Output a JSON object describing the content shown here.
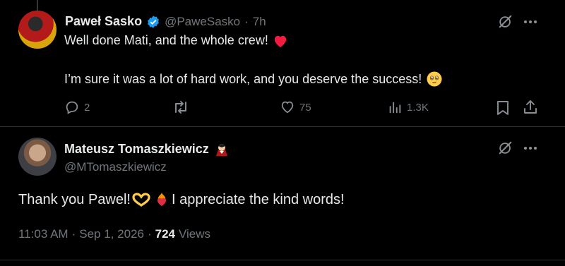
{
  "reply": {
    "author_name": "Paweł Sasko",
    "handle": "@PaweSasko",
    "separator": "·",
    "time_ago": "7h",
    "line1": "Well done Mati, and the whole crew!",
    "line2": "I’m sure it was a lot of hard work, and you deserve the success!",
    "emoji_heart": "❤",
    "emoji_face": "🥹",
    "stats": {
      "replies": "2",
      "likes": "75",
      "views": "1.3K"
    }
  },
  "main_post": {
    "author_name": "Mateusz Tomaszkiewicz",
    "author_emoji": "🧛",
    "handle": "@MTomaszkiewicz",
    "text_part1": "Thank you Pawel!",
    "emoji_hands": "🫶",
    "emoji_fire": "❤️‍🔥",
    "text_part2": "I appreciate the kind words!",
    "time": "11:03 AM",
    "dot1": "·",
    "date": "Sep 1, 2026",
    "dot2": "·",
    "views_count": "724",
    "views_label": "Views"
  },
  "colors": {
    "accent": "#1d9bf0",
    "muted": "#71767b",
    "text": "#e7e9ea",
    "background": "#000000"
  },
  "icons": [
    "verified-badge-icon",
    "grok-icon",
    "more-icon",
    "reply-icon",
    "retweet-icon",
    "like-icon",
    "analytics-icon",
    "bookmark-icon",
    "share-icon"
  ]
}
